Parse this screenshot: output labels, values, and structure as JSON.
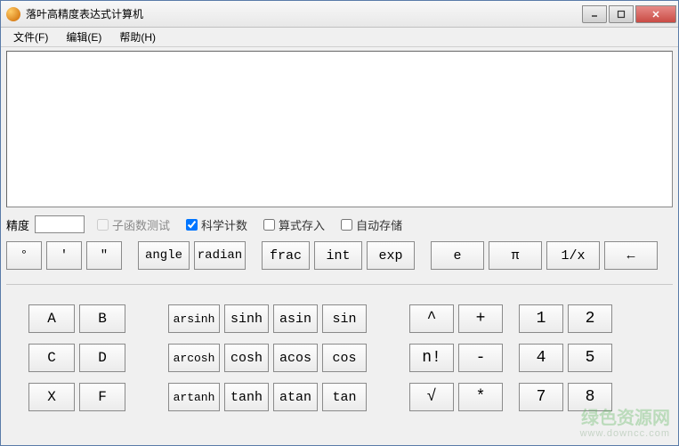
{
  "window": {
    "title": "落叶高精度表达式计算机"
  },
  "menu": {
    "file": "文件(F)",
    "edit": "编辑(E)",
    "help": "帮助(H)"
  },
  "options": {
    "precision_label": "精度",
    "precision_value": "",
    "subfunc_test": "子函数测试",
    "sci_notation": "科学计数",
    "save_expr": "算式存入",
    "auto_save": "自动存储"
  },
  "row1": {
    "deg": "°",
    "min": "′",
    "sec": "″",
    "angle": "angle",
    "radian": "radian",
    "frac": "frac",
    "int": "int",
    "exp": "exp",
    "e": "e",
    "pi": "π",
    "recip": "1/x",
    "back": "←"
  },
  "row2": {
    "A": "A",
    "B": "B",
    "arsinh": "arsinh",
    "sinh": "sinh",
    "asin": "asin",
    "sin": "sin",
    "caret": "^",
    "plus": "+",
    "n1": "1",
    "n2": "2"
  },
  "row3": {
    "C": "C",
    "D": "D",
    "arcosh": "arcosh",
    "cosh": "cosh",
    "acos": "acos",
    "cos": "cos",
    "fact": "n!",
    "minus": "-",
    "n4": "4",
    "n5": "5"
  },
  "row4": {
    "X": "X",
    "F": "F",
    "artanh": "artanh",
    "tanh": "tanh",
    "atan": "atan",
    "tan": "tan",
    "sqrt": "√",
    "mult": "*",
    "n7": "7",
    "n8": "8"
  },
  "watermark": {
    "text": "绿色资源网",
    "url": "www.downcc.com"
  }
}
